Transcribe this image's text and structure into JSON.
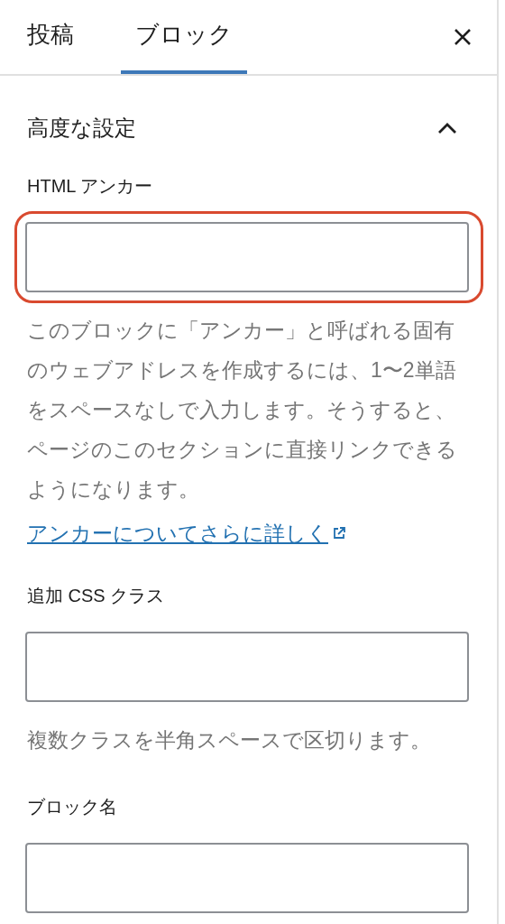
{
  "tabs": [
    {
      "label": "投稿",
      "selected": false
    },
    {
      "label": "ブロック",
      "selected": true
    }
  ],
  "panel": {
    "title": "高度な設定",
    "expanded": true,
    "fields": [
      {
        "label": "HTML アンカー",
        "highlighted": true,
        "help": "このブロックに「アンカー」と呼ばれる固有のウェブアドレスを作成するには、1〜2単語をスペースなしで入力します。そうすると、ページのこのセクションに直接リンクできるようになります。",
        "link": "アンカーについてさらに詳しく"
      },
      {
        "label": "追加 CSS クラス",
        "highlighted": false,
        "help": "複数クラスを半角スペースで区切ります。"
      },
      {
        "label": "ブロック名",
        "highlighted": false
      }
    ]
  }
}
